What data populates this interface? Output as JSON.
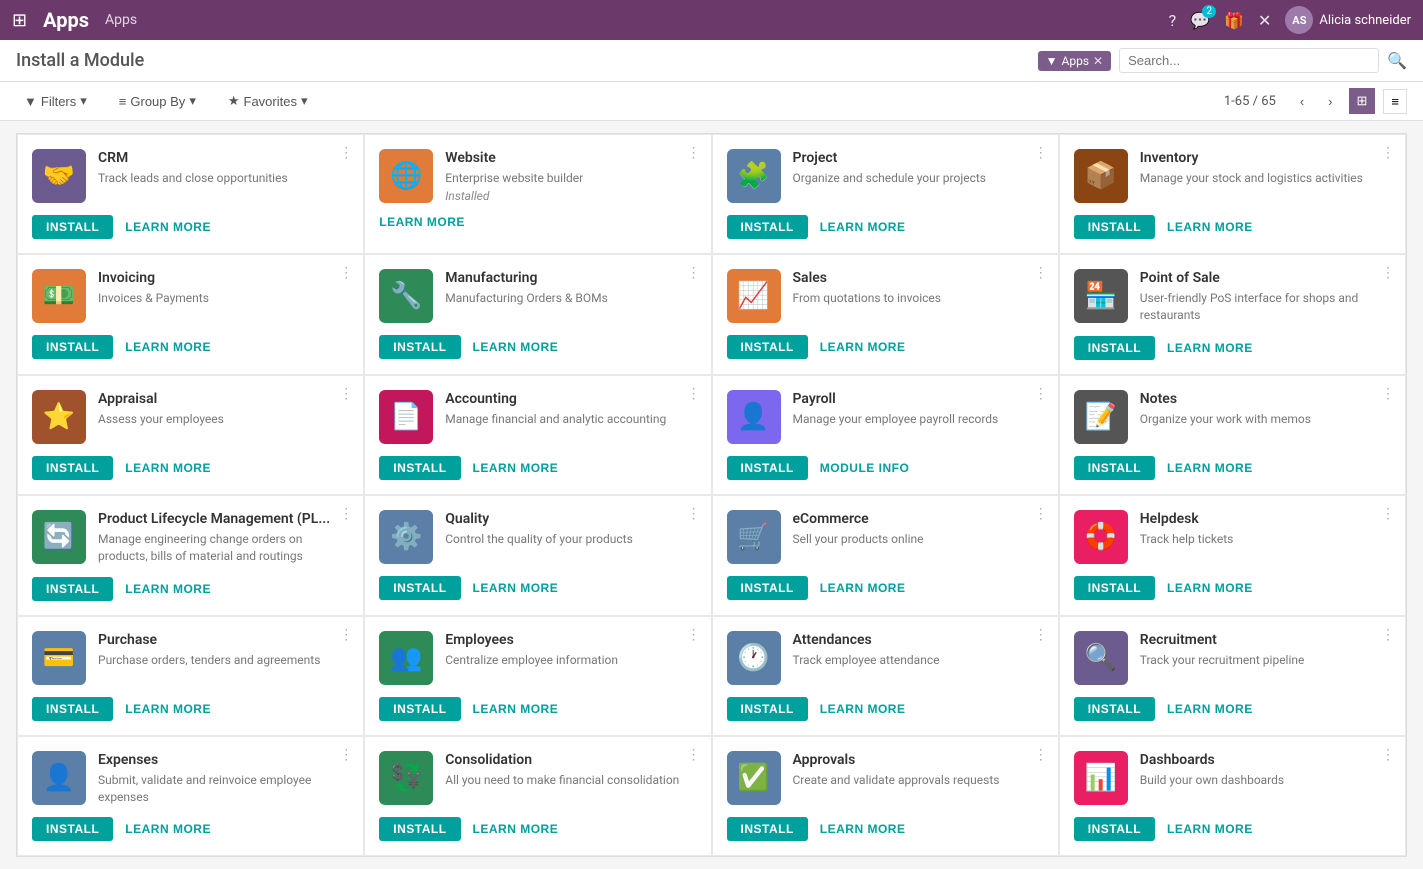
{
  "topNav": {
    "title": "Apps",
    "breadcrumb": "Apps",
    "userName": "Alicia schneider",
    "notificationCount": "2"
  },
  "page": {
    "title": "Install a Module",
    "searchTag": "Apps",
    "searchPlaceholder": "Search...",
    "pagination": "1-65 / 65"
  },
  "toolbar": {
    "filtersLabel": "Filters",
    "groupByLabel": "Group By",
    "favoritesLabel": "Favorites"
  },
  "apps": [
    {
      "id": "crm",
      "name": "CRM",
      "description": "Track leads and close opportunities",
      "color": "#6b5b8e",
      "icon": "🤝",
      "status": null,
      "actions": [
        "install",
        "learn_more"
      ]
    },
    {
      "id": "website",
      "name": "Website",
      "description": "Enterprise website builder",
      "color": "#e07b39",
      "icon": "🌐",
      "status": "Installed",
      "actions": [
        "learn_more"
      ]
    },
    {
      "id": "project",
      "name": "Project",
      "description": "Organize and schedule your projects",
      "color": "#5b7fa6",
      "icon": "🧩",
      "status": null,
      "actions": [
        "install",
        "learn_more"
      ]
    },
    {
      "id": "inventory",
      "name": "Inventory",
      "description": "Manage your stock and logistics activities",
      "color": "#8b4513",
      "icon": "📦",
      "status": null,
      "actions": [
        "install",
        "learn_more"
      ]
    },
    {
      "id": "invoicing",
      "name": "Invoicing",
      "description": "Invoices & Payments",
      "color": "#e07b39",
      "icon": "💵",
      "status": null,
      "actions": [
        "install",
        "learn_more"
      ]
    },
    {
      "id": "manufacturing",
      "name": "Manufacturing",
      "description": "Manufacturing Orders & BOMs",
      "color": "#2e8b57",
      "icon": "🔧",
      "status": null,
      "actions": [
        "install",
        "learn_more"
      ]
    },
    {
      "id": "sales",
      "name": "Sales",
      "description": "From quotations to invoices",
      "color": "#e07b39",
      "icon": "📈",
      "status": null,
      "actions": [
        "install",
        "learn_more"
      ]
    },
    {
      "id": "point_of_sale",
      "name": "Point of Sale",
      "description": "User-friendly PoS interface for shops and restaurants",
      "color": "#555",
      "icon": "🏪",
      "status": null,
      "actions": [
        "install",
        "learn_more"
      ]
    },
    {
      "id": "appraisal",
      "name": "Appraisal",
      "description": "Assess your employees",
      "color": "#a0522d",
      "icon": "⭐",
      "status": null,
      "actions": [
        "install",
        "learn_more"
      ]
    },
    {
      "id": "accounting",
      "name": "Accounting",
      "description": "Manage financial and analytic accounting",
      "color": "#c2185b",
      "icon": "📄",
      "status": null,
      "actions": [
        "install",
        "learn_more"
      ]
    },
    {
      "id": "payroll",
      "name": "Payroll",
      "description": "Manage your employee payroll records",
      "color": "#7b68ee",
      "icon": "👤",
      "status": null,
      "actions": [
        "install",
        "module_info"
      ]
    },
    {
      "id": "notes",
      "name": "Notes",
      "description": "Organize your work with memos",
      "color": "#555",
      "icon": "📝",
      "status": null,
      "actions": [
        "install",
        "learn_more"
      ]
    },
    {
      "id": "plm",
      "name": "Product Lifecycle Management (PL...",
      "description": "Manage engineering change orders on products, bills of material and routings",
      "color": "#2e8b57",
      "icon": "🔄",
      "status": null,
      "actions": [
        "install",
        "learn_more"
      ]
    },
    {
      "id": "quality",
      "name": "Quality",
      "description": "Control the quality of your products",
      "color": "#5b7fa6",
      "icon": "⚙️",
      "status": null,
      "actions": [
        "install",
        "learn_more"
      ]
    },
    {
      "id": "ecommerce",
      "name": "eCommerce",
      "description": "Sell your products online",
      "color": "#5b7fa6",
      "icon": "🛒",
      "status": null,
      "actions": [
        "install",
        "learn_more"
      ]
    },
    {
      "id": "helpdesk",
      "name": "Helpdesk",
      "description": "Track help tickets",
      "color": "#e91e63",
      "icon": "🛟",
      "status": null,
      "actions": [
        "install",
        "learn_more"
      ]
    },
    {
      "id": "purchase",
      "name": "Purchase",
      "description": "Purchase orders, tenders and agreements",
      "color": "#5b7fa6",
      "icon": "💳",
      "status": null,
      "actions": [
        "install",
        "learn_more"
      ]
    },
    {
      "id": "employees",
      "name": "Employees",
      "description": "Centralize employee information",
      "color": "#2e8b57",
      "icon": "👥",
      "status": null,
      "actions": [
        "install",
        "learn_more"
      ]
    },
    {
      "id": "attendances",
      "name": "Attendances",
      "description": "Track employee attendance",
      "color": "#5b7fa6",
      "icon": "🕐",
      "status": null,
      "actions": [
        "install",
        "learn_more"
      ]
    },
    {
      "id": "recruitment",
      "name": "Recruitment",
      "description": "Track your recruitment pipeline",
      "color": "#6b5b8e",
      "icon": "🔍",
      "status": null,
      "actions": [
        "install",
        "learn_more"
      ]
    },
    {
      "id": "expenses",
      "name": "Expenses",
      "description": "Submit, validate and reinvoice employee expenses",
      "color": "#5b7fa6",
      "icon": "👤",
      "status": null,
      "actions": [
        "install",
        "learn_more"
      ]
    },
    {
      "id": "consolidation",
      "name": "Consolidation",
      "description": "All you need to make financial consolidation",
      "color": "#2e8b57",
      "icon": "💱",
      "status": null,
      "actions": [
        "install",
        "learn_more"
      ]
    },
    {
      "id": "approvals",
      "name": "Approvals",
      "description": "Create and validate approvals requests",
      "color": "#5b7fa6",
      "icon": "✅",
      "status": null,
      "actions": [
        "install",
        "learn_more"
      ]
    },
    {
      "id": "dashboards",
      "name": "Dashboards",
      "description": "Build your own dashboards",
      "color": "#e91e63",
      "icon": "📊",
      "status": null,
      "actions": [
        "install",
        "learn_more"
      ]
    }
  ],
  "labels": {
    "install": "INSTALL",
    "learn_more": "LEARN MORE",
    "module_info": "MODULE INFO",
    "filters": "Filters",
    "group_by": "Group By",
    "favorites": "Favorites"
  }
}
